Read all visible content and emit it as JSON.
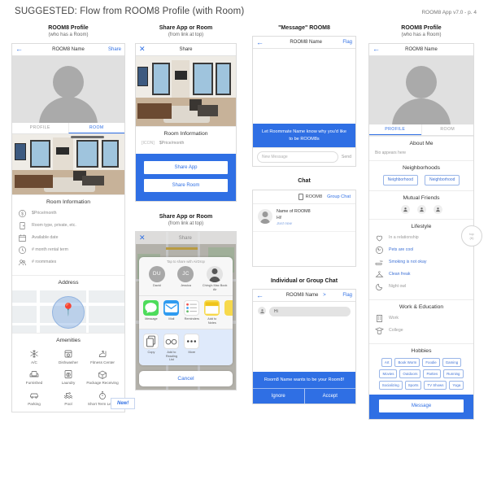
{
  "header": {
    "title": "SUGGESTED: Flow from ROOM8 Profile (with Room)",
    "meta": "ROOM8 App v7.0 -  p. 4"
  },
  "columns": [
    {
      "title": "ROOM8 Profile",
      "subtitle": "(who has a Room)",
      "nav": {
        "title": "ROOM8 Name",
        "right": "Share",
        "left_icon": "back-arrow-icon"
      },
      "tabs": [
        {
          "label": "PROFILE",
          "active": false
        },
        {
          "label": "ROOM",
          "active": true
        }
      ],
      "room_info": {
        "title": "Room Information",
        "rows": [
          {
            "icon": "dollar-circle-icon",
            "label": "$Price/month"
          },
          {
            "icon": "door-icon",
            "label": "Room type, private, etc."
          },
          {
            "icon": "calendar-icon",
            "label": "Available date"
          },
          {
            "icon": "clock-icon",
            "label": "# month rental term"
          },
          {
            "icon": "roommates-icon",
            "label": "# roommates"
          }
        ]
      },
      "address": {
        "title": "Address"
      },
      "amenities": {
        "title": "Amenities",
        "items": [
          {
            "icon": "snowflake-icon",
            "label": "A/C"
          },
          {
            "icon": "dishwasher-icon",
            "label": "Dishwasher"
          },
          {
            "icon": "treadmill-icon",
            "label": "Fitness Center"
          },
          {
            "icon": "armchair-icon",
            "label": "Furnished"
          },
          {
            "icon": "washer-icon",
            "label": "Laundry"
          },
          {
            "icon": "package-icon",
            "label": "Package Receiving"
          },
          {
            "icon": "car-icon",
            "label": "Parking"
          },
          {
            "icon": "pool-icon",
            "label": "Pool"
          },
          {
            "icon": "stopwatch-icon",
            "label": "Short Term Lease"
          }
        ]
      },
      "callout": "New!"
    },
    {
      "title": "Share App or Room",
      "subtitle": "(from link at top)",
      "nav": {
        "title": "Share",
        "left_icon": "close-x-icon"
      },
      "room_info": {
        "title": "Room Information",
        "price_row": {
          "icon_placeholder": "[ICON]",
          "label": "$Price/month"
        }
      },
      "buttons": [
        "Share App",
        "Share Room"
      ],
      "second": {
        "title": "Share App or Room",
        "subtitle": "(from link at top)",
        "nav_title": "Share",
        "hint": "Tap to share with AirDrop",
        "airdrop": [
          {
            "initials": "DU",
            "name": "David"
          },
          {
            "initials": "JC",
            "name": "Jessica"
          },
          {
            "initials": "",
            "name": "Ching's Mac Book Air"
          }
        ],
        "apps": [
          {
            "icon": "message-icon",
            "name": "Message"
          },
          {
            "icon": "mail-icon",
            "name": "Mail"
          },
          {
            "icon": "reminders-icon",
            "name": "Reminders"
          },
          {
            "icon": "notes-icon",
            "name": "Add to Notes"
          }
        ],
        "actions": [
          {
            "icon": "copy-icon",
            "name": "Copy"
          },
          {
            "icon": "glasses-icon",
            "name": "Add to Reading List"
          },
          {
            "icon": "more-dots-icon",
            "name": "More"
          }
        ],
        "cancel": "Cancel"
      }
    },
    {
      "title": "\"Message\" ROOM8",
      "subtitle": "",
      "nav": {
        "title": "ROOM8 Name",
        "right": "Flag",
        "left_icon": "back-arrow-icon"
      },
      "banner": "Let Roommate Name know why you'd like to be ROOM8s",
      "composer": {
        "placeholder": "New Message",
        "send": "Send"
      },
      "chat": {
        "title": "Chat",
        "tab_left": "ROOM8",
        "tab_right": "Group Chat",
        "message": {
          "name": "Name of ROOM8",
          "text": "Hi!",
          "time": "Just now"
        }
      },
      "group": {
        "title": "Individual or Group Chat",
        "nav": {
          "title": "ROOM8 Name",
          "chevron": ">",
          "right": "Flag"
        },
        "bubble": "Hi",
        "banner": "Room8 Name wants to be your Room8!",
        "actions": [
          "Ignore",
          "Accept"
        ]
      }
    },
    {
      "title": "ROOM8 Profile",
      "subtitle": "(who has a Room)",
      "nav": {
        "title": "ROOM8 Name",
        "left_icon": "back-arrow-icon"
      },
      "tabs": [
        {
          "label": "PROFILE",
          "active": true
        },
        {
          "label": "ROOM",
          "active": false
        }
      ],
      "about": {
        "title": "About Me",
        "bio": "Bio appears here"
      },
      "neighborhoods": {
        "title": "Neighborhoods",
        "items": [
          "Neighborhood",
          "Neighborhood"
        ]
      },
      "mutual_friends": {
        "title": "Mutual Friends",
        "count": 3
      },
      "lifestyle": {
        "title": "Lifestyle",
        "items": [
          {
            "icon": "heart-icon",
            "label": "In a relationship",
            "on": false
          },
          {
            "icon": "paw-icon",
            "label": "Pets are cool",
            "on": true
          },
          {
            "icon": "cigarette-icon",
            "label": "Smoking is not okay",
            "on": true
          },
          {
            "icon": "hanger-icon",
            "label": "Clean freak",
            "on": true
          },
          {
            "icon": "moon-icon",
            "label": "Night owl",
            "on": false
          }
        ]
      },
      "work_education": {
        "title": "Work & Education",
        "items": [
          {
            "icon": "building-icon",
            "label": "Work"
          },
          {
            "icon": "graduation-icon",
            "label": "College"
          }
        ]
      },
      "hobbies": {
        "title": "Hobbies",
        "items": [
          "Art",
          "Book Worm",
          "Foodie",
          "Gaming",
          "Movies",
          "Outdoors",
          "Parties",
          "Running",
          "Socializing",
          "Sports",
          "TV Shows",
          "Yoga"
        ]
      },
      "message_button": "Message",
      "badge": {
        "line1": "top",
        "line2": "(6)"
      }
    }
  ],
  "colors": {
    "accent": "#2f6fe4",
    "chip_border": "#9ab6e8",
    "muted": "#9a9a9a"
  }
}
